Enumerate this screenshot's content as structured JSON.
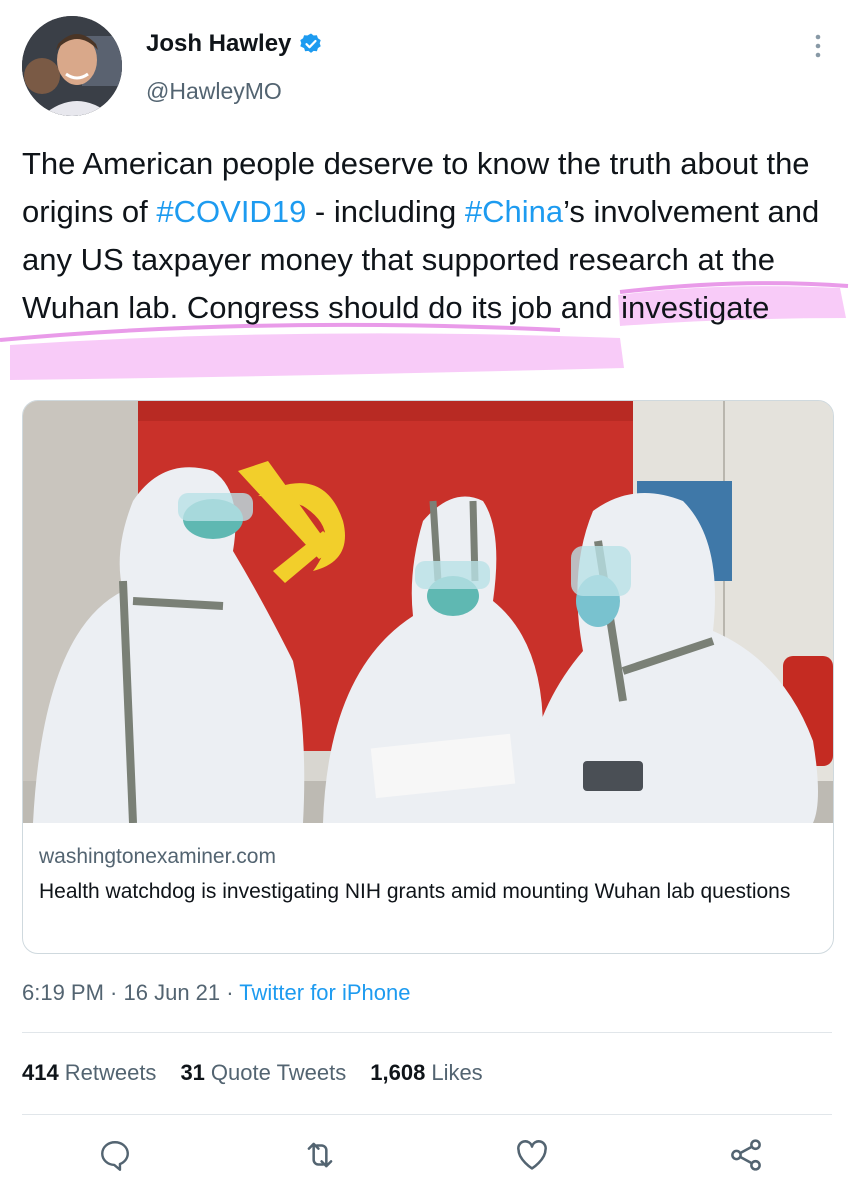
{
  "author": {
    "name": "Josh Hawley",
    "handle": "@HawleyMO",
    "verified_icon": "verified-badge-icon"
  },
  "tweet": {
    "text_parts": {
      "p1": "The American people deserve to know the truth about the origins of ",
      "tag1": "#COVID19",
      "p2": " - including ",
      "tag2": "#China",
      "p3": "’s involvement and any US taxpayer money that supported research at the Wuhan lab. Congress should do its job and investigate"
    }
  },
  "link_card": {
    "domain": "washingtonexaminer.com",
    "title": "Health watchdog is investigating NIH grants amid mounting Wuhan lab questions"
  },
  "meta": {
    "time": "6:19 PM",
    "sep1": " · ",
    "date": "16 Jun 21",
    "sep2": " · ",
    "source": "Twitter for iPhone"
  },
  "stats": {
    "retweets_count": "414",
    "retweets_label": "Retweets",
    "quotes_count": "31",
    "quotes_label": "Quote Tweets",
    "likes_count": "1,608",
    "likes_label": "Likes"
  },
  "icons": {
    "reply": "reply-icon",
    "retweet": "retweet-icon",
    "like": "heart-icon",
    "share": "share-icon",
    "more": "more-options-icon"
  },
  "colors": {
    "link": "#1d9bf0",
    "text": "#0f1419",
    "muted": "#536471",
    "highlight": "#f08cf0"
  }
}
